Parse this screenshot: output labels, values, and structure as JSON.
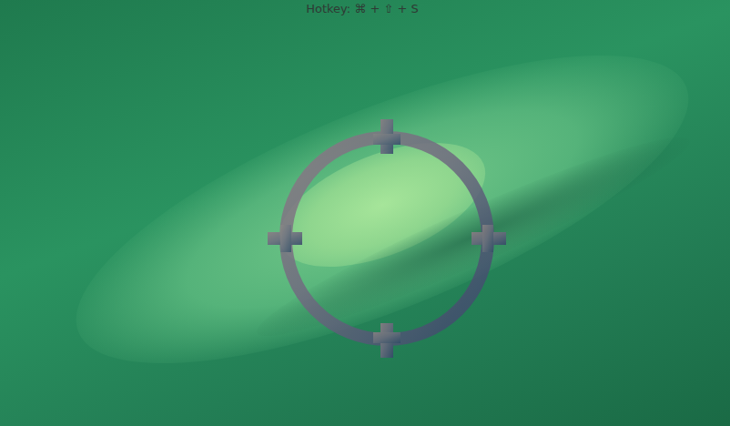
{
  "hint": {
    "text": "Hotkey: ⌘ + ⇧ + S"
  }
}
